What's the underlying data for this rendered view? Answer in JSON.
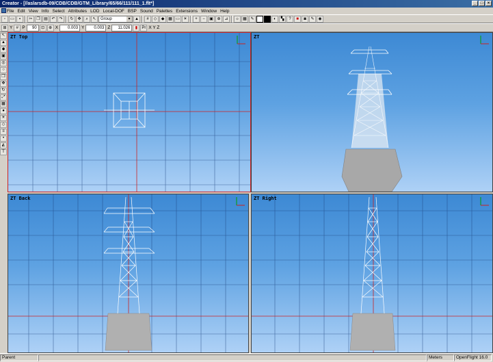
{
  "window": {
    "title": "Creator - [//aslarsdb-09/CDB/CDB/GTM_Library/65/66/111/111_1.flt*]",
    "min": "_",
    "max": "□",
    "close": "×"
  },
  "menu": [
    "File",
    "Edit",
    "View",
    "Info",
    "Select",
    "Attributes",
    "LOD",
    "Local-DOF",
    "BSP",
    "Sound",
    "Palettes",
    "Extensions",
    "Window",
    "Help"
  ],
  "toolbar": {
    "mode_combo": "Group",
    "x_label": "X",
    "x_value": "0.003",
    "y_label": "Y",
    "y_value": "0.003",
    "z_label": "Z",
    "z_value": "11.026",
    "grid_count": "90",
    "p_label": "P",
    "xyz_flags": "X  Y  Z"
  },
  "viewports": {
    "top": "ZT Top",
    "perspective": "ZT",
    "back": "ZT Back",
    "right": "ZT Right"
  },
  "status": {
    "parent": "Parent",
    "units": "Meters",
    "version": "OpenFlight 16.0"
  },
  "colors": {
    "viewport_top": "#3d89d4",
    "viewport_bottom": "#aed1f6",
    "grid_line": "#1a3e7a",
    "axis_line": "#cc2222",
    "tower": "#e8f0f8",
    "base": "#b8b8b8"
  }
}
